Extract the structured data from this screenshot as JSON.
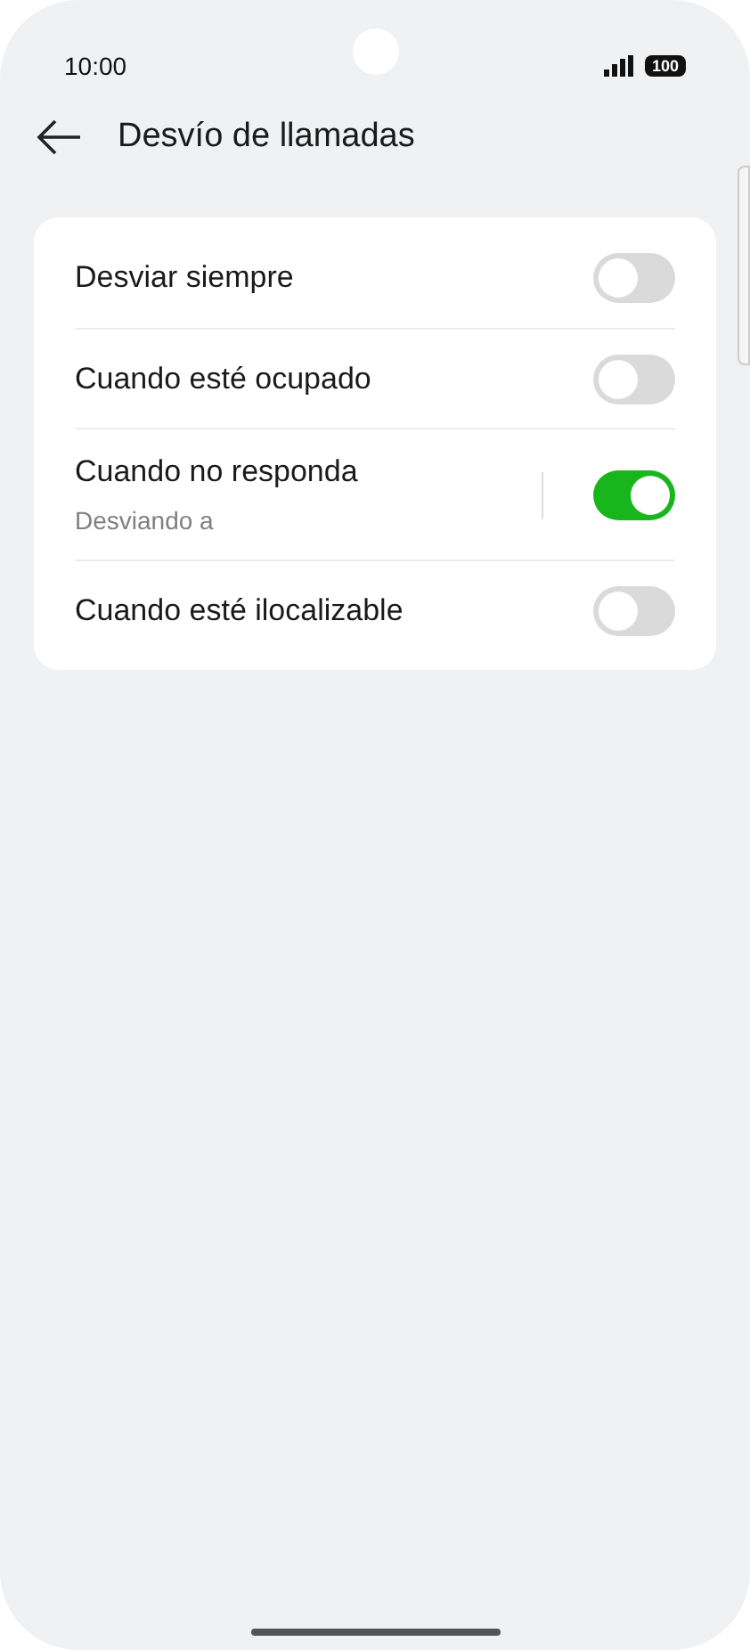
{
  "status_bar": {
    "time": "10:00",
    "battery": "100"
  },
  "header": {
    "title": "Desvío de llamadas"
  },
  "settings": [
    {
      "label": "Desviar siempre",
      "on": false
    },
    {
      "label": "Cuando esté ocupado",
      "on": false
    },
    {
      "label": "Cuando no responda",
      "subtitle": "Desviando a",
      "on": true
    },
    {
      "label": "Cuando esté ilocalizable",
      "on": false
    }
  ]
}
